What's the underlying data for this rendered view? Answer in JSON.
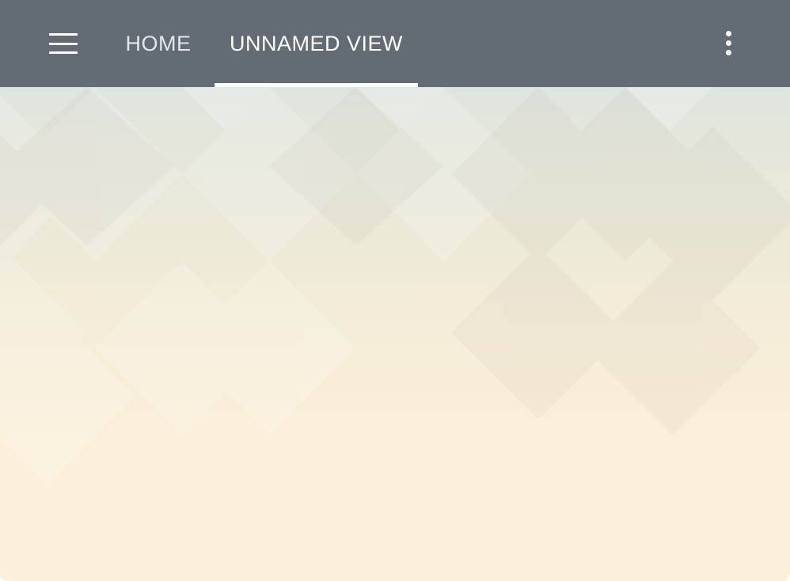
{
  "topbar": {
    "menu_icon": "hamburger-menu-icon",
    "overflow_icon": "more-vertical-icon",
    "background_color": "#636b74"
  },
  "tabs": [
    {
      "label": "HOME",
      "active": false
    },
    {
      "label": "UNNAMED VIEW",
      "active": true
    }
  ],
  "theme": {
    "indicator_color": "#ffffff",
    "background_top_color": "#cfe7e2",
    "background_bottom_color": "#fcf0da"
  }
}
